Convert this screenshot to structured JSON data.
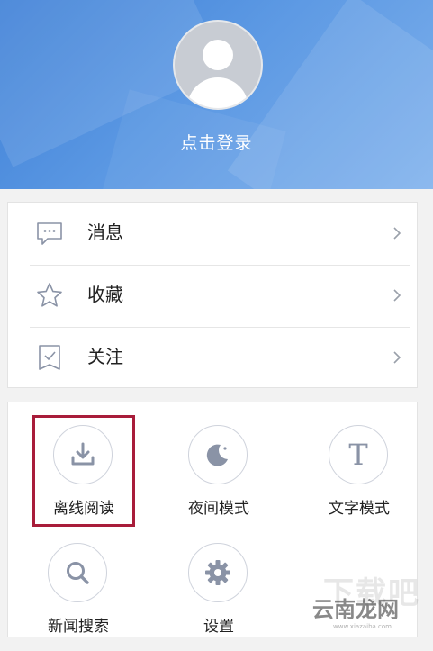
{
  "profile": {
    "login_label": "点击登录"
  },
  "menu": {
    "items": [
      {
        "label": "消息",
        "icon": "message-icon"
      },
      {
        "label": "收藏",
        "icon": "star-icon"
      },
      {
        "label": "关注",
        "icon": "bookmark-icon"
      }
    ]
  },
  "tools": {
    "items": [
      {
        "label": "离线阅读",
        "icon": "download-icon"
      },
      {
        "label": "夜间模式",
        "icon": "moon-icon"
      },
      {
        "label": "文字模式",
        "icon": "text-icon",
        "glyph": "T"
      },
      {
        "label": "新闻搜索",
        "icon": "search-icon"
      },
      {
        "label": "设置",
        "icon": "gear-icon"
      }
    ]
  },
  "watermark": {
    "main": "云南龙网",
    "big": "下载吧",
    "url": "www.xiazaiba.com"
  },
  "colors": {
    "header_gradient_start": "#3d7fd6",
    "header_gradient_end": "#7fb1ec",
    "icon_gray": "#8a93a6",
    "highlight": "#a81d3a"
  }
}
